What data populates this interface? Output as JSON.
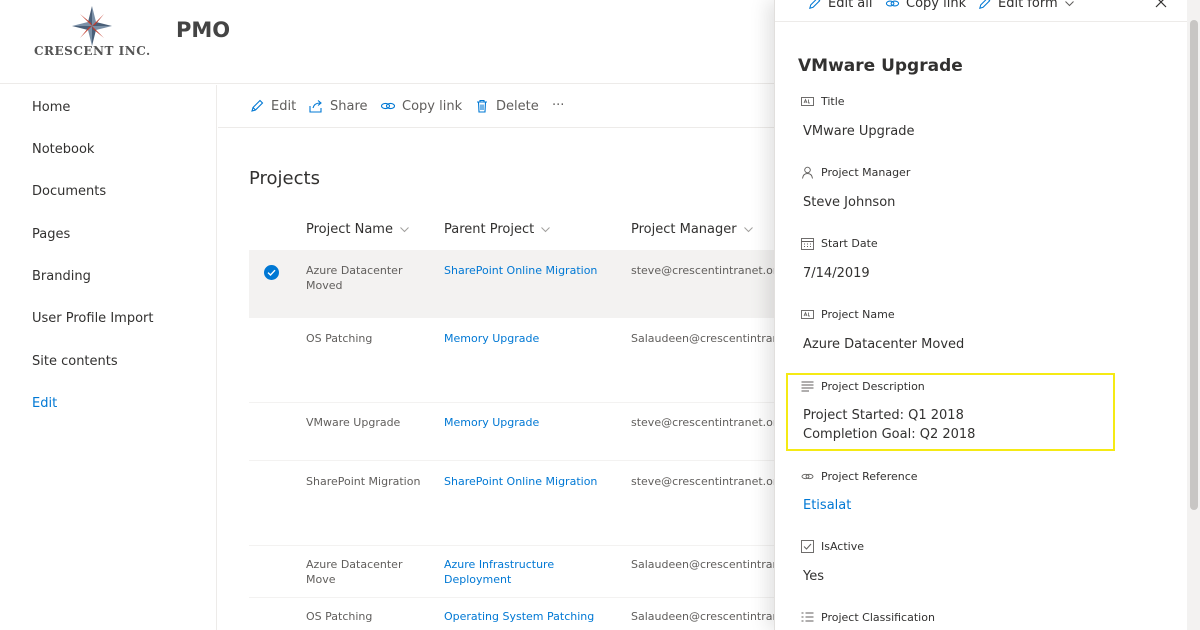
{
  "brand": {
    "logo_text": "CRESCENT INC.",
    "site_title": "PMO",
    "accent": "#0078d4",
    "highlight": "#f5ea14"
  },
  "nav": {
    "items": [
      {
        "label": "Home"
      },
      {
        "label": "Notebook"
      },
      {
        "label": "Documents"
      },
      {
        "label": "Pages"
      },
      {
        "label": "Branding"
      },
      {
        "label": "User Profile Import"
      },
      {
        "label": "Site contents"
      },
      {
        "label": "Edit"
      }
    ]
  },
  "commandbar": {
    "edit": "Edit",
    "share": "Share",
    "copy_link": "Copy link",
    "delete": "Delete",
    "more": "···"
  },
  "list": {
    "title": "Projects",
    "columns": [
      "Project Name",
      "Parent Project",
      "Project Manager"
    ],
    "rows": [
      {
        "name": "Azure Datacenter Moved",
        "parent": "SharePoint Online Migration",
        "manager": "steve@crescentintranet.or",
        "selected": true
      },
      {
        "name": "OS Patching",
        "parent": "Memory Upgrade",
        "manager": "Salaudeen@crescentintrar",
        "selected": false
      },
      {
        "name": "VMware Upgrade",
        "parent": "Memory Upgrade",
        "manager": "steve@crescentintranet.or",
        "selected": false
      },
      {
        "name": "SharePoint Migration",
        "parent": "SharePoint Online Migration",
        "manager": "steve@crescentintranet.or",
        "selected": false
      },
      {
        "name": "Azure Datacenter Move",
        "parent": "Azure Infrastructure Deployment",
        "manager": "Salaudeen@crescentintrar",
        "selected": false
      },
      {
        "name": "OS Patching",
        "parent": "Operating System Patching",
        "manager": "Salaudeen@crescentintrar",
        "selected": false
      }
    ]
  },
  "panel": {
    "toolbar": {
      "edit_all": "Edit all",
      "copy_link": "Copy link",
      "edit_form": "Edit form"
    },
    "title": "VMware Upgrade",
    "fields": [
      {
        "label": "Title",
        "value": "VMware Upgrade",
        "icon": "text-field-icon"
      },
      {
        "label": "Project Manager",
        "value": "Steve Johnson",
        "icon": "person-icon"
      },
      {
        "label": "Start Date",
        "value": "7/14/2019",
        "icon": "calendar-icon"
      },
      {
        "label": "Project Name",
        "value": "Azure Datacenter Moved",
        "icon": "text-field-icon"
      },
      {
        "label": "Project Description",
        "value_line1": "Project Started: Q1 2018",
        "value_line2": "Completion Goal: Q2 2018",
        "icon": "multiline-text-icon"
      },
      {
        "label": "Project Reference",
        "value": "Etisalat",
        "icon": "link-icon"
      },
      {
        "label": "IsActive",
        "value": "Yes",
        "icon": "checkbox-icon"
      },
      {
        "label": "Project Classification",
        "icon": "list-icon"
      }
    ]
  }
}
